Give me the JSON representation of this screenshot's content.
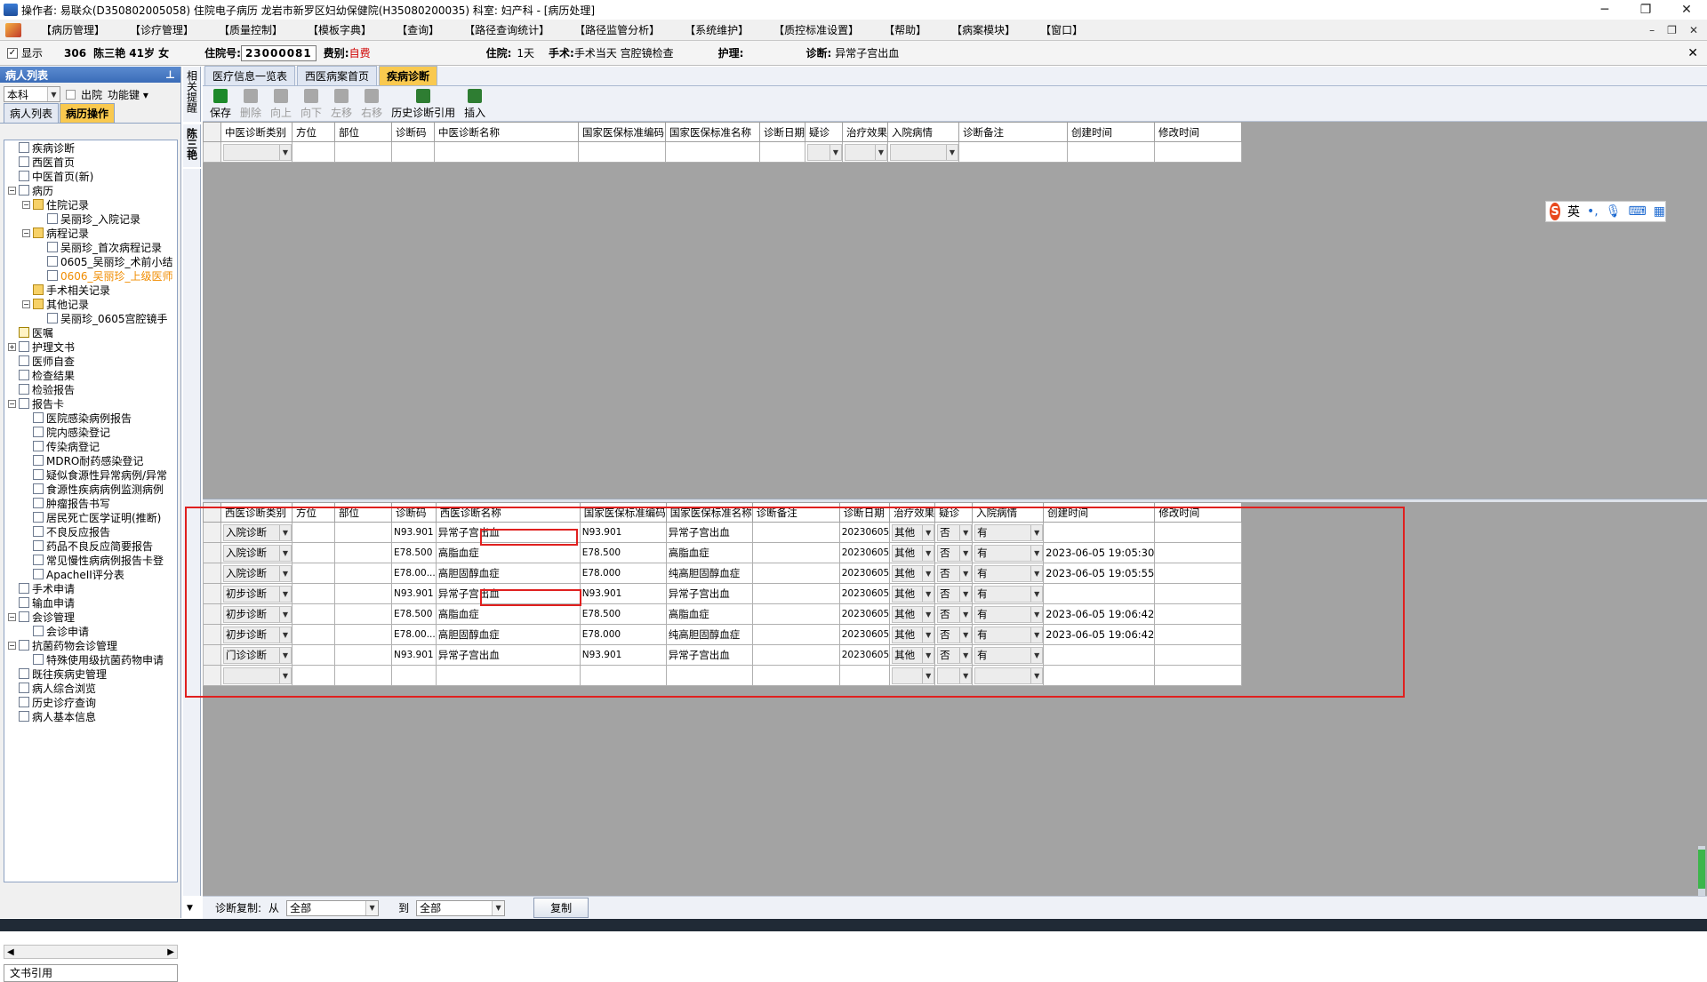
{
  "titlebar": {
    "title": "操作者: 易联众(D350802005058) 住院电子病历  龙岩市新罗区妇幼保健院(H35080200035)  科室: 妇产科 - [病历处理]"
  },
  "menu": [
    "【病历管理】",
    "【诊疗管理】",
    "【质量控制】",
    "【模板字典】",
    "【查询】",
    "【路径查询统计】",
    "【路径监管分析】",
    "【系统维护】",
    "【质控标准设置】",
    "【帮助】",
    "【病案模块】",
    "【窗口】"
  ],
  "infobar": {
    "show_label": "显示",
    "bed": "306",
    "patient": "陈三艳 41岁 女",
    "zyh_label": "住院号:",
    "zyh": "23000081",
    "fee_label": "费别:",
    "fee": "自费",
    "stay_label": "住院:",
    "stay": "1天",
    "surgery_label": "手术:",
    "surgery": "手术当天 宫腔镜检查",
    "nursing_label": "护理:",
    "diag_label": "诊断:",
    "diag": "异常子宫出血"
  },
  "left": {
    "title": "病人列表",
    "dept": "本科",
    "discharge": "出院",
    "func": "功能键",
    "tabs": [
      "病人列表",
      "病历操作"
    ],
    "tree": [
      {
        "label": "疾病诊断",
        "level": 1,
        "icon": "check"
      },
      {
        "label": "西医首页",
        "level": 1,
        "icon": "doc"
      },
      {
        "label": "中医首页(新)",
        "level": 1,
        "icon": "doc"
      },
      {
        "label": "病历",
        "level": 1,
        "icon": "doc",
        "exp": "−"
      },
      {
        "label": "住院记录",
        "level": 2,
        "icon": "folder",
        "exp": "−"
      },
      {
        "label": "吴丽珍_入院记录",
        "level": 3,
        "icon": "doc"
      },
      {
        "label": "病程记录",
        "level": 2,
        "icon": "folder",
        "exp": "−"
      },
      {
        "label": "吴丽珍_首次病程记录",
        "level": 3,
        "icon": "doc"
      },
      {
        "label": "0605_吴丽珍_术前小结",
        "level": 3,
        "icon": "doc"
      },
      {
        "label": "0606_吴丽珍_上级医师",
        "level": 3,
        "icon": "doc",
        "orange": true
      },
      {
        "label": "手术相关记录",
        "level": 2,
        "icon": "folder"
      },
      {
        "label": "其他记录",
        "level": 2,
        "icon": "folder",
        "exp": "−"
      },
      {
        "label": "吴丽珍_0605宫腔镜手",
        "level": 3,
        "icon": "doc"
      },
      {
        "label": "医嘱",
        "level": 1,
        "icon": "pad"
      },
      {
        "label": "护理文书",
        "level": 1,
        "icon": "doc",
        "exp": "+"
      },
      {
        "label": "医师自查",
        "level": 1,
        "icon": "doc"
      },
      {
        "label": "检查结果",
        "level": 1,
        "icon": "doc"
      },
      {
        "label": "检验报告",
        "level": 1,
        "icon": "doc"
      },
      {
        "label": "报告卡",
        "level": 1,
        "icon": "doc",
        "exp": "−"
      },
      {
        "label": "医院感染病例报告",
        "level": 2,
        "icon": "doc"
      },
      {
        "label": "院内感染登记",
        "level": 2,
        "icon": "doc"
      },
      {
        "label": "传染病登记",
        "level": 2,
        "icon": "doc"
      },
      {
        "label": "MDRO耐药感染登记",
        "level": 2,
        "icon": "doc"
      },
      {
        "label": "疑似食源性异常病例/异常",
        "level": 2,
        "icon": "doc"
      },
      {
        "label": "食源性疾病病例监测病例",
        "level": 2,
        "icon": "doc"
      },
      {
        "label": "肿瘤报告书写",
        "level": 2,
        "icon": "doc"
      },
      {
        "label": "居民死亡医学证明(推断)",
        "level": 2,
        "icon": "doc"
      },
      {
        "label": "不良反应报告",
        "level": 2,
        "icon": "doc"
      },
      {
        "label": "药品不良反应简要报告",
        "level": 2,
        "icon": "doc"
      },
      {
        "label": "常见慢性病病例报告卡登",
        "level": 2,
        "icon": "doc"
      },
      {
        "label": "ApacheII评分表",
        "level": 2,
        "icon": "doc"
      },
      {
        "label": "手术申请",
        "level": 1,
        "icon": "doc"
      },
      {
        "label": "输血申请",
        "level": 1,
        "icon": "doc"
      },
      {
        "label": "会诊管理",
        "level": 1,
        "icon": "doc",
        "exp": "−"
      },
      {
        "label": "会诊申请",
        "level": 2,
        "icon": "doc"
      },
      {
        "label": "抗菌药物会诊管理",
        "level": 1,
        "icon": "doc",
        "exp": "−"
      },
      {
        "label": "特殊使用级抗菌药物申请",
        "level": 2,
        "icon": "doc"
      },
      {
        "label": "既往疾病史管理",
        "level": 1,
        "icon": "doc"
      },
      {
        "label": "病人综合浏览",
        "level": 1,
        "icon": "doc"
      },
      {
        "label": "历史诊疗查询",
        "level": 1,
        "icon": "doc"
      },
      {
        "label": "病人基本信息",
        "level": 1,
        "icon": "doc"
      }
    ],
    "bottom": "文书引用"
  },
  "vstrip1": "相关提醒",
  "vstrip2": "陈三艳",
  "doc_tabs": [
    "医疗信息一览表",
    "西医病案首页",
    "疾病诊断"
  ],
  "toolbar": [
    {
      "label": "保存",
      "enabled": true,
      "color": "#1d8a2a"
    },
    {
      "label": "删除",
      "enabled": false,
      "color": "#a8a8a8"
    },
    {
      "label": "向上",
      "enabled": false,
      "color": "#a8a8a8"
    },
    {
      "label": "向下",
      "enabled": false,
      "color": "#a8a8a8"
    },
    {
      "label": "左移",
      "enabled": false,
      "color": "#a8a8a8"
    },
    {
      "label": "右移",
      "enabled": false,
      "color": "#a8a8a8"
    },
    {
      "label": "历史诊断引用",
      "enabled": true,
      "color": "#2e7d32"
    },
    {
      "label": "插入",
      "enabled": true,
      "color": "#2e7d32"
    }
  ],
  "tcm_grid": {
    "headers": [
      "中医诊断类别",
      "方位",
      "部位",
      "诊断码",
      "中医诊断名称",
      "国家医保标准编码",
      "国家医保标准名称",
      "诊断日期",
      "疑诊",
      "治疗效果",
      "入院病情",
      "诊断备注",
      "创建时间",
      "修改时间"
    ]
  },
  "wm_grid": {
    "headers": [
      "西医诊断类别",
      "方位",
      "部位",
      "诊断码",
      "西医诊断名称",
      "国家医保标准编码",
      "国家医保标准名称",
      "诊断备注",
      "诊断日期",
      "治疗效果",
      "疑诊",
      "入院病情",
      "创建时间",
      "修改时间"
    ],
    "rows": [
      {
        "type": "入院诊断",
        "code": "N93.901",
        "name": "异常子宫出血",
        "yb_code": "N93.901",
        "yb_name": "异常子宫出血",
        "date": "20230605",
        "effect": "其他",
        "suspect": "否",
        "cond": "有",
        "created": ""
      },
      {
        "type": "入院诊断",
        "code": "E78.500",
        "name": "高脂血症",
        "yb_code": "E78.500",
        "yb_name": "高脂血症",
        "date": "20230605",
        "effect": "其他",
        "suspect": "否",
        "cond": "有",
        "created": "2023-06-05 19:05:30"
      },
      {
        "type": "入院诊断",
        "code": "E78.00...",
        "name": "高胆固醇血症",
        "yb_code": "E78.000",
        "yb_name": "纯高胆固醇血症",
        "date": "20230605",
        "effect": "其他",
        "suspect": "否",
        "cond": "有",
        "created": "2023-06-05 19:05:55"
      },
      {
        "type": "初步诊断",
        "code": "N93.901",
        "name": "异常子宫出血",
        "yb_code": "N93.901",
        "yb_name": "异常子宫出血",
        "date": "20230605",
        "effect": "其他",
        "suspect": "否",
        "cond": "有",
        "created": ""
      },
      {
        "type": "初步诊断",
        "code": "E78.500",
        "name": "高脂血症",
        "yb_code": "E78.500",
        "yb_name": "高脂血症",
        "date": "20230605",
        "effect": "其他",
        "suspect": "否",
        "cond": "有",
        "created": "2023-06-05 19:06:42"
      },
      {
        "type": "初步诊断",
        "code": "E78.00...",
        "name": "高胆固醇血症",
        "yb_code": "E78.000",
        "yb_name": "纯高胆固醇血症",
        "date": "20230605",
        "effect": "其他",
        "suspect": "否",
        "cond": "有",
        "created": "2023-06-05 19:06:42"
      },
      {
        "type": "门诊诊断",
        "code": "N93.901",
        "name": "异常子宫出血",
        "yb_code": "N93.901",
        "yb_name": "异常子宫出血",
        "date": "20230605",
        "effect": "其他",
        "suspect": "否",
        "cond": "有",
        "created": ""
      }
    ]
  },
  "bottom": {
    "copy_label": "诊断复制:",
    "from_label": "从",
    "from": "全部",
    "to_label": "到",
    "to": "全部",
    "copy_button": "复制"
  },
  "ime": {
    "lang": "英"
  }
}
